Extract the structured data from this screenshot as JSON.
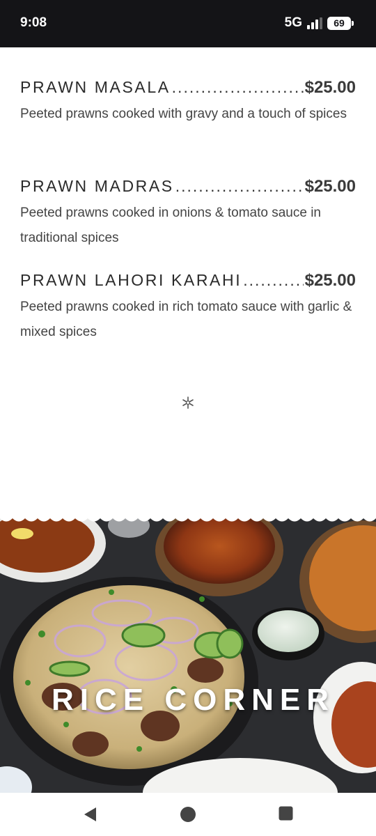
{
  "status_bar": {
    "time": "9:08",
    "network": "5G",
    "battery": "69"
  },
  "menu_items": [
    {
      "name": "PRAWN MASALA",
      "price": "$25.00",
      "description": "Peeted prawns cooked with gravy and a touch of spices"
    },
    {
      "name": "PRAWN MADRAS",
      "price": "$25.00",
      "description": "Peeted prawns cooked in onions & tomato sauce in traditional spices"
    },
    {
      "name": "PRAWN LAHORI KARAHI",
      "price": "$25.00",
      "description": "Peeted prawns cooked in rich tomato sauce with garlic & mixed spices"
    }
  ],
  "divider_icon": "asterisk-icon",
  "banner": {
    "title": "RICE CORNER"
  },
  "nav_bar": {
    "back_icon": "back-triangle-icon",
    "home_icon": "home-circle-icon",
    "recents_icon": "recents-square-icon"
  }
}
